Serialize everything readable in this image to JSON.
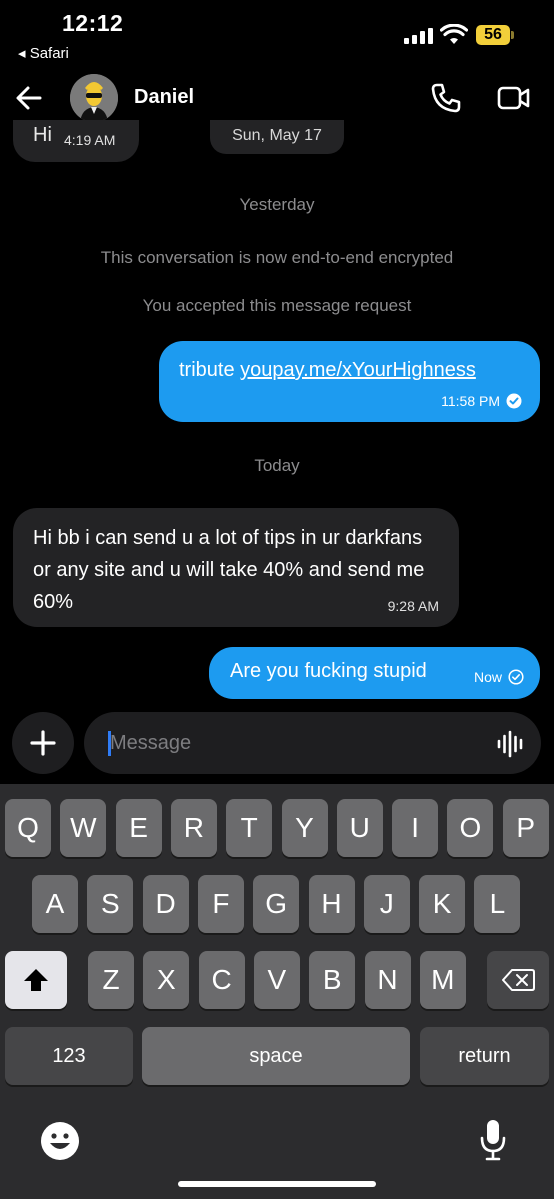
{
  "status_bar": {
    "time": "12:12",
    "back_app": "◂ Safari",
    "battery": "56"
  },
  "header": {
    "contact_name": "Daniel"
  },
  "conversation": {
    "previous": {
      "text": "Hi",
      "time": "4:19 AM",
      "date": "Sun, May 17"
    },
    "day_yesterday": "Yesterday",
    "encryption_notice": "This conversation is now end-to-end encrypted",
    "request_notice": "You accepted this message request",
    "messages": [
      {
        "direction": "outgoing",
        "text_prefix": "tribute ",
        "link": "youpay.me/xYourHighness",
        "time": "11:58 PM",
        "status": "read"
      },
      {
        "direction": "incoming",
        "text": "Hi bb i can send u a lot of tips in ur darkfans or any site and u will take 40% and send me 60%",
        "time": "9:28 AM"
      },
      {
        "direction": "outgoing",
        "text": "Are you fucking stupid",
        "time": "Now",
        "status": "sent"
      }
    ],
    "day_today": "Today"
  },
  "composer": {
    "placeholder": "Message"
  },
  "keyboard": {
    "row1": [
      "Q",
      "W",
      "E",
      "R",
      "T",
      "Y",
      "U",
      "I",
      "O",
      "P"
    ],
    "row2": [
      "A",
      "S",
      "D",
      "F",
      "G",
      "H",
      "J",
      "K",
      "L"
    ],
    "row3": [
      "Z",
      "X",
      "C",
      "V",
      "B",
      "N",
      "M"
    ],
    "numbers_label": "123",
    "space_label": "space",
    "return_label": "return"
  },
  "colors": {
    "accent": "#1d9bf0",
    "incoming_bubble": "#232325",
    "background": "#000000"
  }
}
